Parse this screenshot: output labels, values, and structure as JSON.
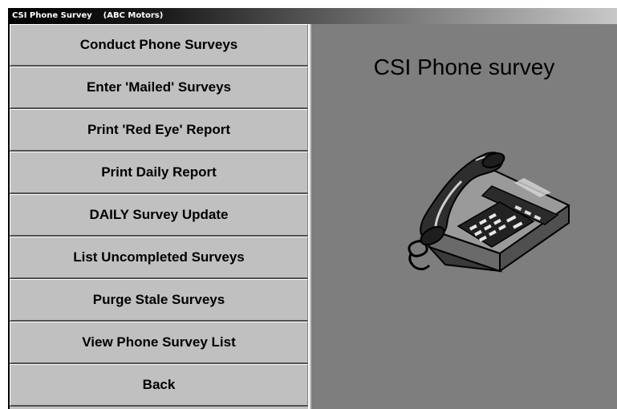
{
  "window": {
    "title": "CSI Phone Survey    (ABC Motors)"
  },
  "menu": {
    "items": [
      {
        "label": "Conduct Phone Surveys"
      },
      {
        "label": "Enter 'Mailed' Surveys"
      },
      {
        "label": "Print 'Red Eye' Report"
      },
      {
        "label": "Print Daily Report"
      },
      {
        "label": "DAILY Survey Update"
      },
      {
        "label": "List Uncompleted Surveys"
      },
      {
        "label": "Purge Stale Surveys"
      },
      {
        "label": "View Phone Survey List"
      },
      {
        "label": "Back"
      }
    ]
  },
  "panel": {
    "heading": "CSI Phone survey",
    "illustration_icon": "desk-telephone-icon"
  },
  "colors": {
    "button_face": "#c0c0c0",
    "panel_background": "#7e7e7e",
    "title_bar_start": "#000000",
    "title_bar_end": "#c8c8c8"
  }
}
